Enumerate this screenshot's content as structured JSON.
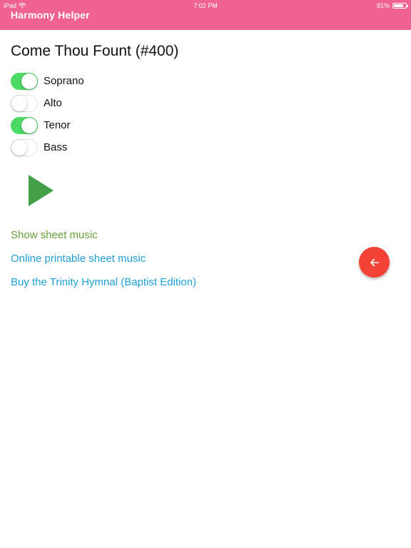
{
  "status_bar": {
    "device": "iPad",
    "time": "7:02 PM",
    "battery": "81%",
    "battery_level": 0.81
  },
  "app": {
    "title": "Harmony Helper",
    "header_color": "#f06292"
  },
  "hymn": {
    "title": "Come Thou Fount (#400)"
  },
  "voices": [
    {
      "label": "Soprano",
      "enabled": true
    },
    {
      "label": "Alto",
      "enabled": false
    },
    {
      "label": "Tenor",
      "enabled": true
    },
    {
      "label": "Bass",
      "enabled": false
    }
  ],
  "controls": {
    "play_icon": "play-icon",
    "play_color": "#43a047"
  },
  "links": {
    "show_sheet_music": "Show sheet music",
    "online_printable": "Online printable sheet music",
    "buy_hymnal": "Buy the Trinity Hymnal (Baptist Edition)"
  },
  "fab": {
    "icon": "arrow-left-icon",
    "color": "#f44336"
  }
}
